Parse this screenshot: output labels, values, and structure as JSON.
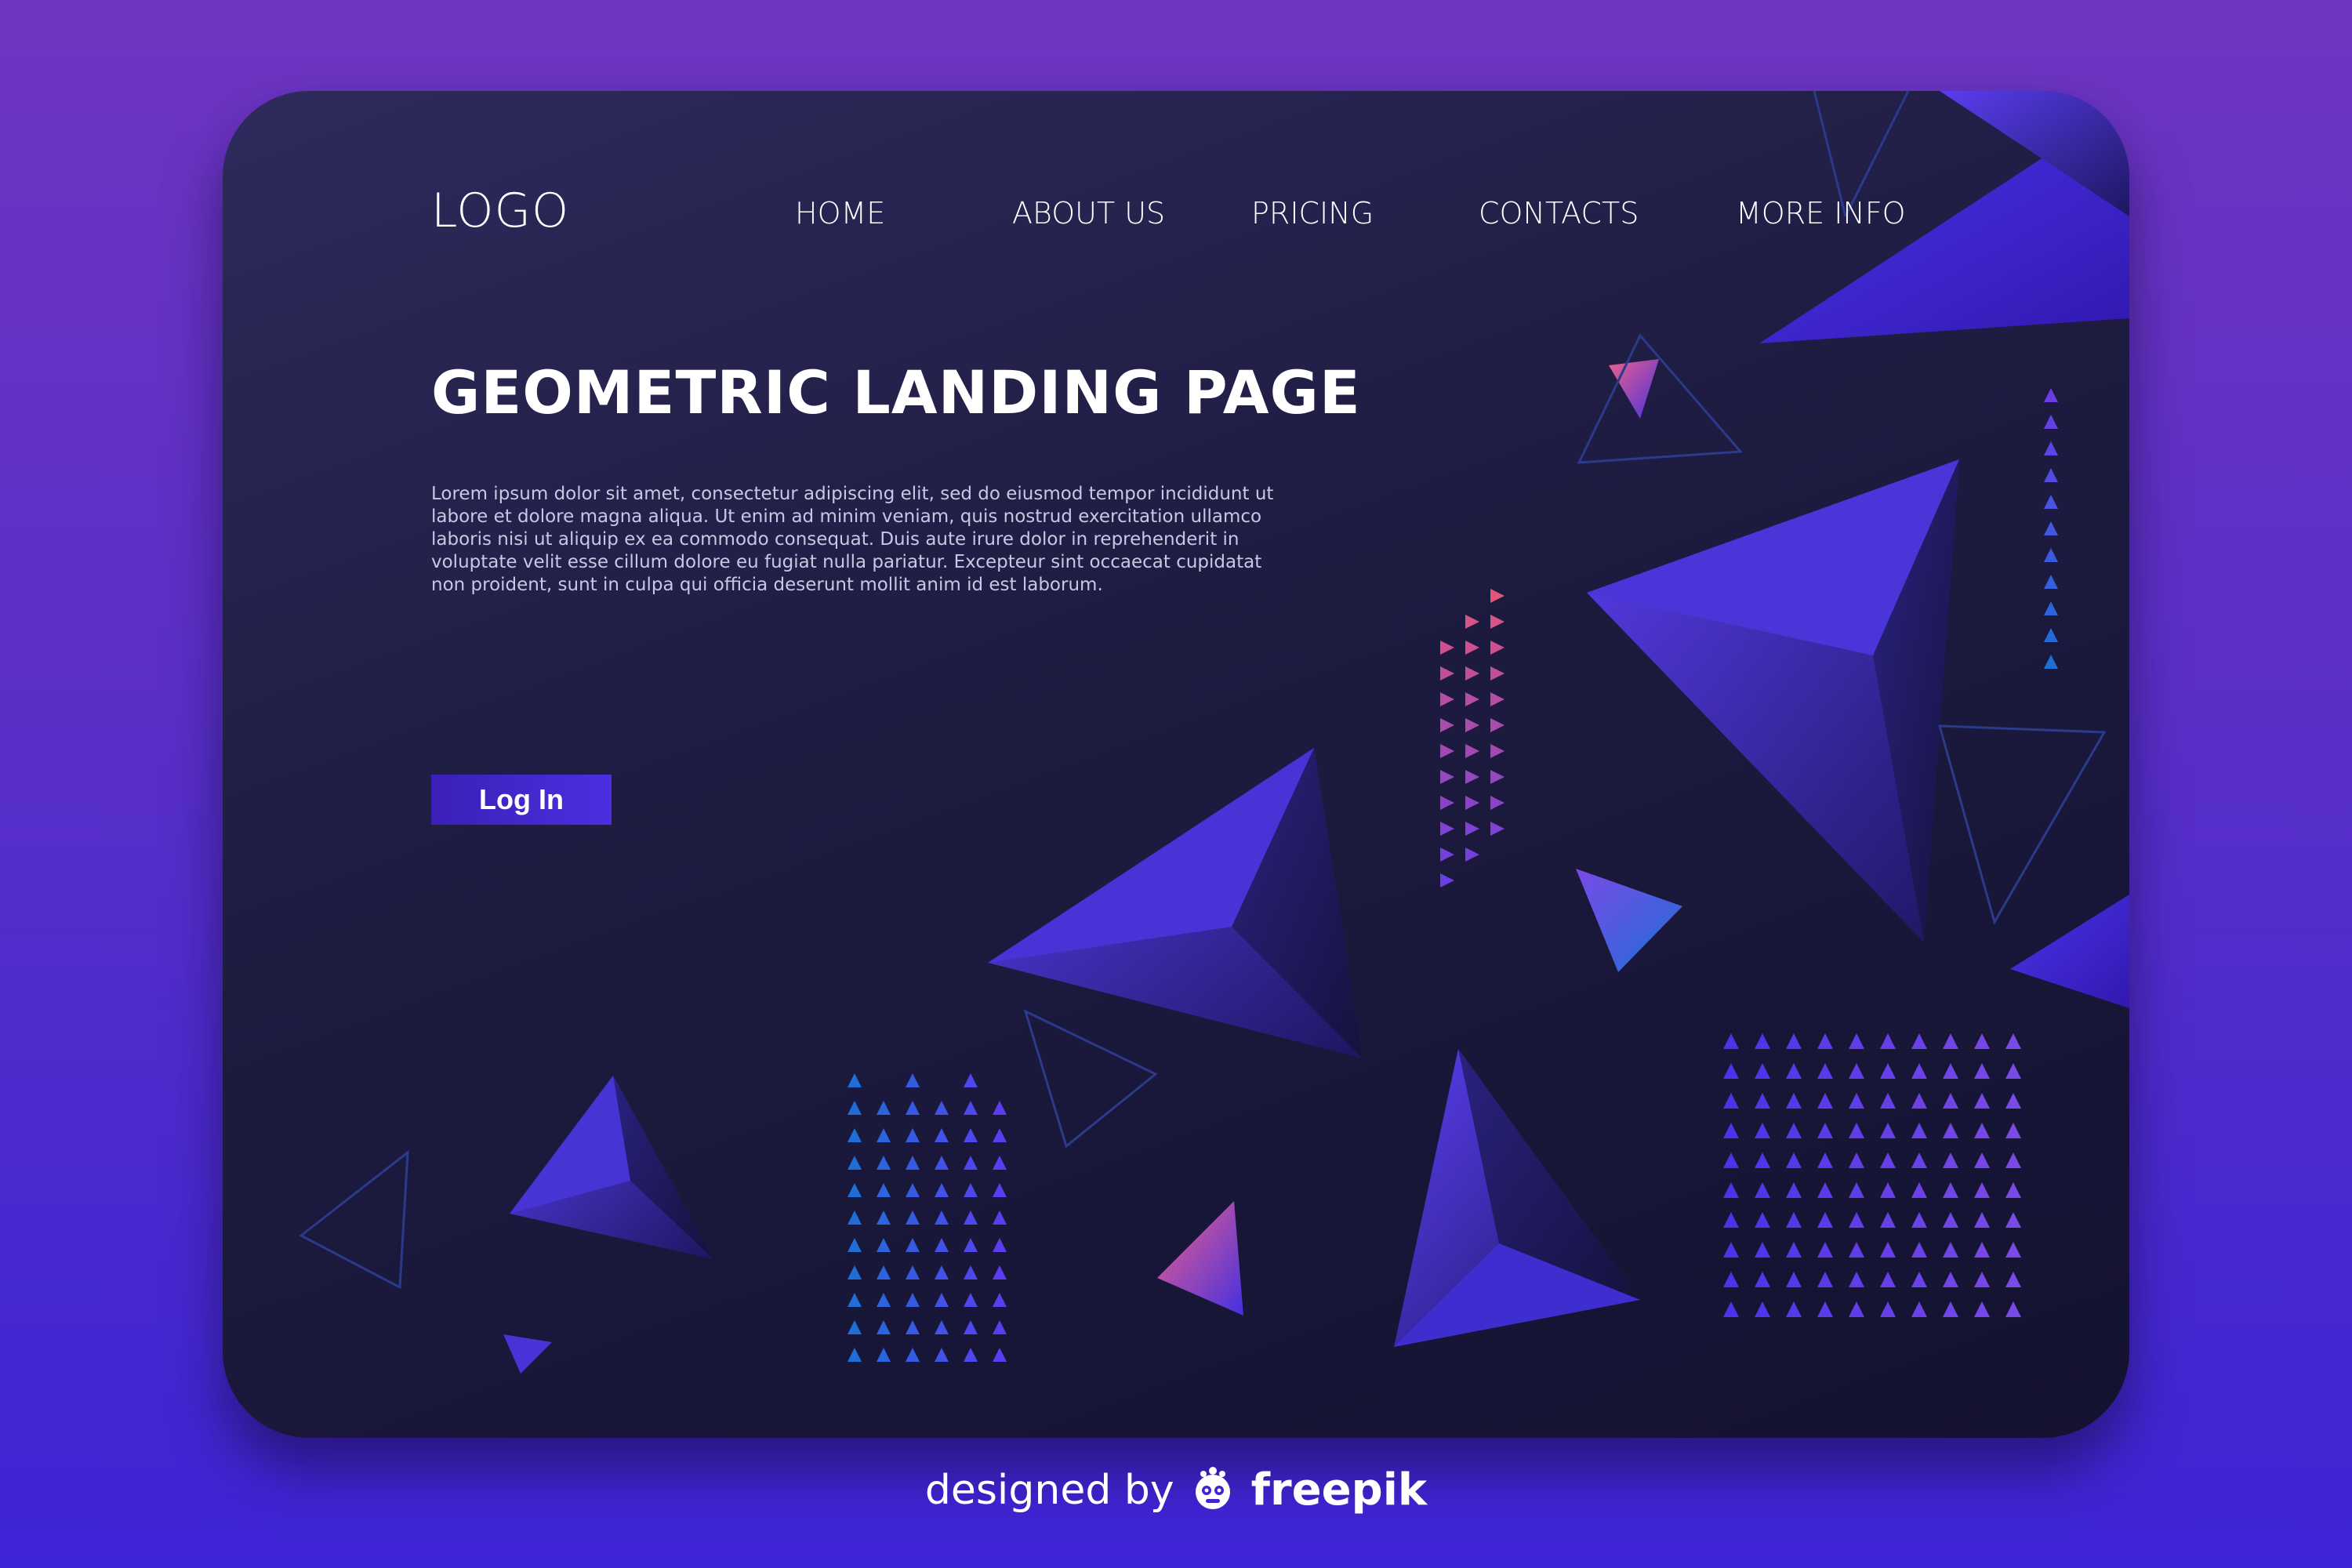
{
  "header": {
    "logo": "LOGO",
    "nav": [
      {
        "label": "HOME"
      },
      {
        "label": "ABOUT US"
      },
      {
        "label": "PRICING"
      },
      {
        "label": "CONTACTS"
      },
      {
        "label": "MORE INFO"
      }
    ]
  },
  "hero": {
    "title": "GEOMETRIC LANDING PAGE",
    "body": "Lorem ipsum dolor sit amet, consectetur adipiscing elit, sed do eiusmod tempor incididunt ut labore et dolore magna aliqua. Ut enim ad minim veniam, quis nostrud exercitation ullamco laboris nisi ut aliquip ex ea commodo consequat. Duis aute irure dolor in reprehenderit in voluptate velit esse cillum dolore eu fugiat nulla pariatur. Excepteur sint occaecat cupidatat non proident, sunt in culpa qui officia deserunt mollit anim id est laborum.",
    "button_label": "Log In"
  },
  "credit": {
    "prefix": "designed by",
    "brand": "freepik"
  },
  "colors": {
    "background_top": "#6e35c0",
    "background_bottom": "#3d24d4",
    "card": "#1d1b40",
    "accent": "#4b2fe0",
    "pink_accent": "#e2567a"
  },
  "icons": {
    "freepik_logo": "freepik-mascot-icon"
  }
}
